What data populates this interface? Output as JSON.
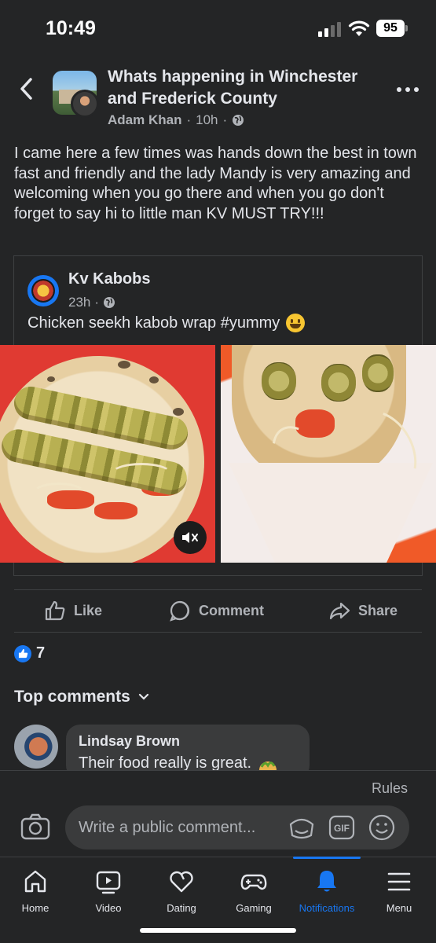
{
  "status_bar": {
    "time": "10:49",
    "battery": "95"
  },
  "header": {
    "group_name": "Whats happening in Winchester and Frederick County",
    "author": "Adam Khan",
    "time": "10h"
  },
  "post": {
    "text": "I came here a few times was hands down the best in town fast and friendly and the lady Mandy is very amazing and welcoming when you go there and when you go don't forget to say hi to little man KV  MUST TRY!!!"
  },
  "shared_post": {
    "page_name": "Kv Kabobs",
    "time": "23h",
    "caption": "Chicken seekh kabob wrap #yummy"
  },
  "actions": {
    "like": "Like",
    "comment": "Comment",
    "share": "Share"
  },
  "reactions": {
    "count": "7"
  },
  "top_comments_label": "Top comments",
  "comment": {
    "author": "Lindsay Brown",
    "text": "Their food really is great."
  },
  "composer": {
    "rules": "Rules",
    "placeholder": "Write a public comment..."
  },
  "tabs": [
    {
      "label": "Home",
      "icon": "home-icon"
    },
    {
      "label": "Video",
      "icon": "video-icon"
    },
    {
      "label": "Dating",
      "icon": "heart-icon"
    },
    {
      "label": "Gaming",
      "icon": "gamepad-icon"
    },
    {
      "label": "Notifications",
      "icon": "bell-icon",
      "active": true
    },
    {
      "label": "Menu",
      "icon": "menu-icon"
    }
  ],
  "colors": {
    "background": "#242526",
    "accent": "#1877f2",
    "bubble": "#3a3b3c",
    "muted": "#b0b3b8"
  }
}
